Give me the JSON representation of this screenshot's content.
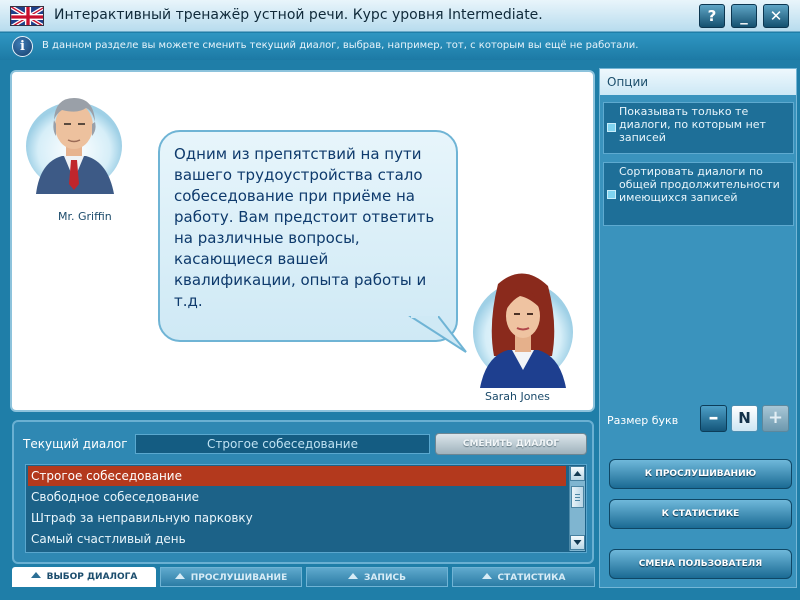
{
  "window": {
    "title": "Интерактивный тренажёр устной речи. Курс уровня Intermediate.",
    "help_label": "?",
    "minimize_label": "_",
    "close_label": "✕"
  },
  "info": {
    "text": "В данном разделе вы можете сменить текущий диалог, выбрав, например, тот, с которым вы ещё не работали."
  },
  "scene": {
    "left_character": "Mr. Griffin",
    "right_character": "Sarah Jones",
    "bubble_text": "Одним из препятствий на пути вашего трудоустройства стало собеседование при приёме на работу. Вам предстоит ответить на различные вопросы, касающиеся вашей квалификации, опыта работы и т.д."
  },
  "options": {
    "title": "Опции",
    "items": [
      {
        "label": "Показывать только те диалоги, по которым нет записей"
      },
      {
        "label": "Сортировать диалоги по общей продолжительности имеющихся записей"
      }
    ],
    "font_size_label": "Размер букв",
    "font_minus": "–",
    "font_normal": "N",
    "font_plus": "+",
    "buttons": {
      "listen": "К ПРОСЛУШИВАНИЮ",
      "stats": "К СТАТИСТИКЕ",
      "change_user": "СМЕНА ПОЛЬЗОВАТЕЛЯ"
    }
  },
  "current_dialog": {
    "label": "Текущий диалог",
    "value": "Строгое собеседование",
    "change_button": "СМЕНИТЬ ДИАЛОГ"
  },
  "dialogs": [
    "Строгое собеседование",
    "Свободное собеседование",
    "Штраф за неправильную парковку",
    "Самый счастливый день"
  ],
  "tabs": [
    {
      "label": "ВЫБОР ДИАЛОГА"
    },
    {
      "label": "ПРОСЛУШИВАНИЕ"
    },
    {
      "label": "ЗАПИСЬ"
    },
    {
      "label": "СТАТИСТИКА"
    }
  ],
  "colors": {
    "background": "#1f7ea8",
    "selected_item": "#b3391d",
    "bubble_text": "#0e3a6c"
  }
}
